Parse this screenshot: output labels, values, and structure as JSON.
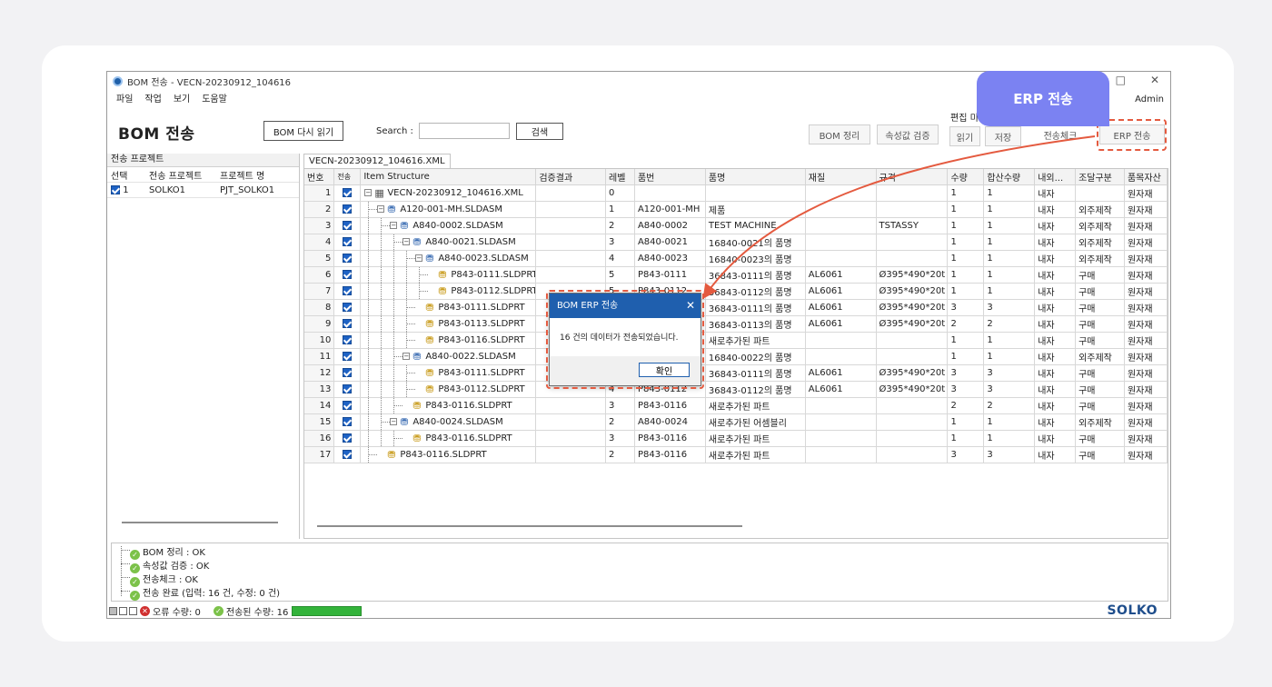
{
  "window": {
    "title": "BOM 전송 - VECN-20230912_104616",
    "minimize_glyph": "—",
    "maximize_glyph": "□",
    "close_glyph": "✕",
    "menu": [
      "파일",
      "작업",
      "보기",
      "도움말"
    ],
    "user": "Admin"
  },
  "toolbar": {
    "heading": "BOM 전송",
    "reload_label": "BOM 다시 읽기",
    "search_label": "Search :",
    "search_value": "",
    "search_button": "검색",
    "bom_clean": "BOM 정리",
    "attr_validate": "속성값 검증",
    "edit_label": "편집 미",
    "read": "읽기",
    "save": "저장",
    "send_check": "전송체크",
    "erp_send": "ERP 전송"
  },
  "left_panel": {
    "header": "전송 프로젝트",
    "columns": [
      "선택",
      "전송 프로젝트",
      "프로젝트 명"
    ],
    "rows": [
      {
        "no": "1",
        "project": "SOLKO1",
        "name": "PJT_SOLKO1"
      }
    ]
  },
  "file_tab": "VECN-20230912_104616.XML",
  "grid": {
    "columns": [
      "번호",
      "전송",
      "Item Structure",
      "검증결과",
      "레벨",
      "품번",
      "품명",
      "재질",
      "규격",
      "수량",
      "합산수량",
      "내외...",
      "조달구분",
      "품목자산"
    ],
    "rows": [
      {
        "no": "1",
        "item": "VECN-20230912_104616.XML",
        "depth": 0,
        "icon": "xml",
        "toggle": "⊟",
        "level": "0",
        "part": "",
        "name": "",
        "material": "",
        "spec": "",
        "qty": "1",
        "sum": "1",
        "inout": "내자",
        "proc": "",
        "asset": "원자재"
      },
      {
        "no": "2",
        "item": "A120-001-MH.SLDASM",
        "depth": 1,
        "icon": "asm",
        "toggle": "⊟",
        "level": "1",
        "part": "A120-001-MH",
        "name": "제품",
        "material": "",
        "spec": "",
        "qty": "1",
        "sum": "1",
        "inout": "내자",
        "proc": "외주제작",
        "asset": "원자재"
      },
      {
        "no": "3",
        "item": "A840-0002.SLDASM",
        "depth": 2,
        "icon": "asm",
        "toggle": "⊟",
        "level": "2",
        "part": "A840-0002",
        "name": "TEST MACHINE",
        "material": "",
        "spec": "TSTASSY",
        "qty": "1",
        "sum": "1",
        "inout": "내자",
        "proc": "외주제작",
        "asset": "원자재"
      },
      {
        "no": "4",
        "item": "A840-0021.SLDASM",
        "depth": 3,
        "icon": "asm",
        "toggle": "⊟",
        "level": "3",
        "part": "A840-0021",
        "name": "16840-0021의 품명",
        "material": "",
        "spec": "",
        "qty": "1",
        "sum": "1",
        "inout": "내자",
        "proc": "외주제작",
        "asset": "원자재"
      },
      {
        "no": "5",
        "item": "A840-0023.SLDASM",
        "depth": 4,
        "icon": "asm",
        "toggle": "⊟",
        "level": "4",
        "part": "A840-0023",
        "name": "16840-0023의 품명",
        "material": "",
        "spec": "",
        "qty": "1",
        "sum": "1",
        "inout": "내자",
        "proc": "외주제작",
        "asset": "원자재"
      },
      {
        "no": "6",
        "item": "P843-0111.SLDPRT",
        "depth": 5,
        "icon": "prt",
        "toggle": "",
        "level": "5",
        "part": "P843-0111",
        "name": "36843-0111의 품명",
        "material": "AL6061",
        "spec": "Ø395*490*20t",
        "qty": "1",
        "sum": "1",
        "inout": "내자",
        "proc": "구매",
        "asset": "원자재"
      },
      {
        "no": "7",
        "item": "P843-0112.SLDPRT",
        "depth": 5,
        "icon": "prt",
        "toggle": "",
        "level": "5",
        "part": "P843-0112",
        "name": "36843-0112의 품명",
        "material": "AL6061",
        "spec": "Ø395*490*20t",
        "qty": "1",
        "sum": "1",
        "inout": "내자",
        "proc": "구매",
        "asset": "원자재"
      },
      {
        "no": "8",
        "item": "P843-0111.SLDPRT",
        "depth": 4,
        "icon": "prt",
        "toggle": "",
        "level": "4",
        "part": "P843-0111",
        "name": "36843-0111의 품명",
        "material": "AL6061",
        "spec": "Ø395*490*20t",
        "qty": "3",
        "sum": "3",
        "inout": "내자",
        "proc": "구매",
        "asset": "원자재"
      },
      {
        "no": "9",
        "item": "P843-0113.SLDPRT",
        "depth": 4,
        "icon": "prt",
        "toggle": "",
        "level": "4",
        "part": "P843-0113",
        "name": "36843-0113의 품명",
        "material": "AL6061",
        "spec": "Ø395*490*20t",
        "qty": "2",
        "sum": "2",
        "inout": "내자",
        "proc": "구매",
        "asset": "원자재"
      },
      {
        "no": "10",
        "item": "P843-0116.SLDPRT",
        "depth": 4,
        "icon": "prt",
        "toggle": "",
        "level": "4",
        "part": "P843-0116",
        "name": "새로추가된 파트",
        "material": "",
        "spec": "",
        "qty": "1",
        "sum": "1",
        "inout": "내자",
        "proc": "구매",
        "asset": "원자재"
      },
      {
        "no": "11",
        "item": "A840-0022.SLDASM",
        "depth": 3,
        "icon": "asm",
        "toggle": "⊟",
        "level": "3",
        "part": "A840-0022",
        "name": "16840-0022의 품명",
        "material": "",
        "spec": "",
        "qty": "1",
        "sum": "1",
        "inout": "내자",
        "proc": "외주제작",
        "asset": "원자재"
      },
      {
        "no": "12",
        "item": "P843-0111.SLDPRT",
        "depth": 4,
        "icon": "prt",
        "toggle": "",
        "level": "4",
        "part": "P843-0111",
        "name": "36843-0111의 품명",
        "material": "AL6061",
        "spec": "Ø395*490*20t",
        "qty": "3",
        "sum": "3",
        "inout": "내자",
        "proc": "구매",
        "asset": "원자재"
      },
      {
        "no": "13",
        "item": "P843-0112.SLDPRT",
        "depth": 4,
        "icon": "prt",
        "toggle": "",
        "level": "4",
        "part": "P843-0112",
        "name": "36843-0112의 품명",
        "material": "AL6061",
        "spec": "Ø395*490*20t",
        "qty": "3",
        "sum": "3",
        "inout": "내자",
        "proc": "구매",
        "asset": "원자재"
      },
      {
        "no": "14",
        "item": "P843-0116.SLDPRT",
        "depth": 3,
        "icon": "prt",
        "toggle": "",
        "level": "3",
        "part": "P843-0116",
        "name": "새로추가된 파트",
        "material": "",
        "spec": "",
        "qty": "2",
        "sum": "2",
        "inout": "내자",
        "proc": "구매",
        "asset": "원자재"
      },
      {
        "no": "15",
        "item": "A840-0024.SLDASM",
        "depth": 2,
        "icon": "asm",
        "toggle": "⊟",
        "level": "2",
        "part": "A840-0024",
        "name": "새로추가된 어셈블리",
        "material": "",
        "spec": "",
        "qty": "1",
        "sum": "1",
        "inout": "내자",
        "proc": "외주제작",
        "asset": "원자재"
      },
      {
        "no": "16",
        "item": "P843-0116.SLDPRT",
        "depth": 3,
        "icon": "prt",
        "toggle": "",
        "level": "3",
        "part": "P843-0116",
        "name": "새로추가된 파트",
        "material": "",
        "spec": "",
        "qty": "1",
        "sum": "1",
        "inout": "내자",
        "proc": "구매",
        "asset": "원자재"
      },
      {
        "no": "17",
        "item": "P843-0116.SLDPRT",
        "depth": 1,
        "icon": "prt",
        "toggle": "",
        "level": "2",
        "part": "P843-0116",
        "name": "새로추가된 파트",
        "material": "",
        "spec": "",
        "qty": "3",
        "sum": "3",
        "inout": "내자",
        "proc": "구매",
        "asset": "원자재"
      }
    ]
  },
  "log": [
    "BOM 정리 : OK",
    "속성값 검증 : OK",
    "전송체크 : OK",
    "전송 완료 (입력: 16 건, 수정: 0 건)"
  ],
  "status": {
    "error": "오류 수량: 0",
    "sent": "전송된 수량: 16",
    "progress": 1.0,
    "brand": "SOLKO"
  },
  "dialog": {
    "title": "BOM ERP 전송",
    "message": "16 건의 데이터가 전송되었습니다.",
    "ok": "확인"
  },
  "callout": "ERP 전송",
  "colors": {
    "accent": "#1f5fae",
    "callout": "#7b82f2",
    "highlight": "#e45a3f",
    "ok": "#7cc24a"
  }
}
